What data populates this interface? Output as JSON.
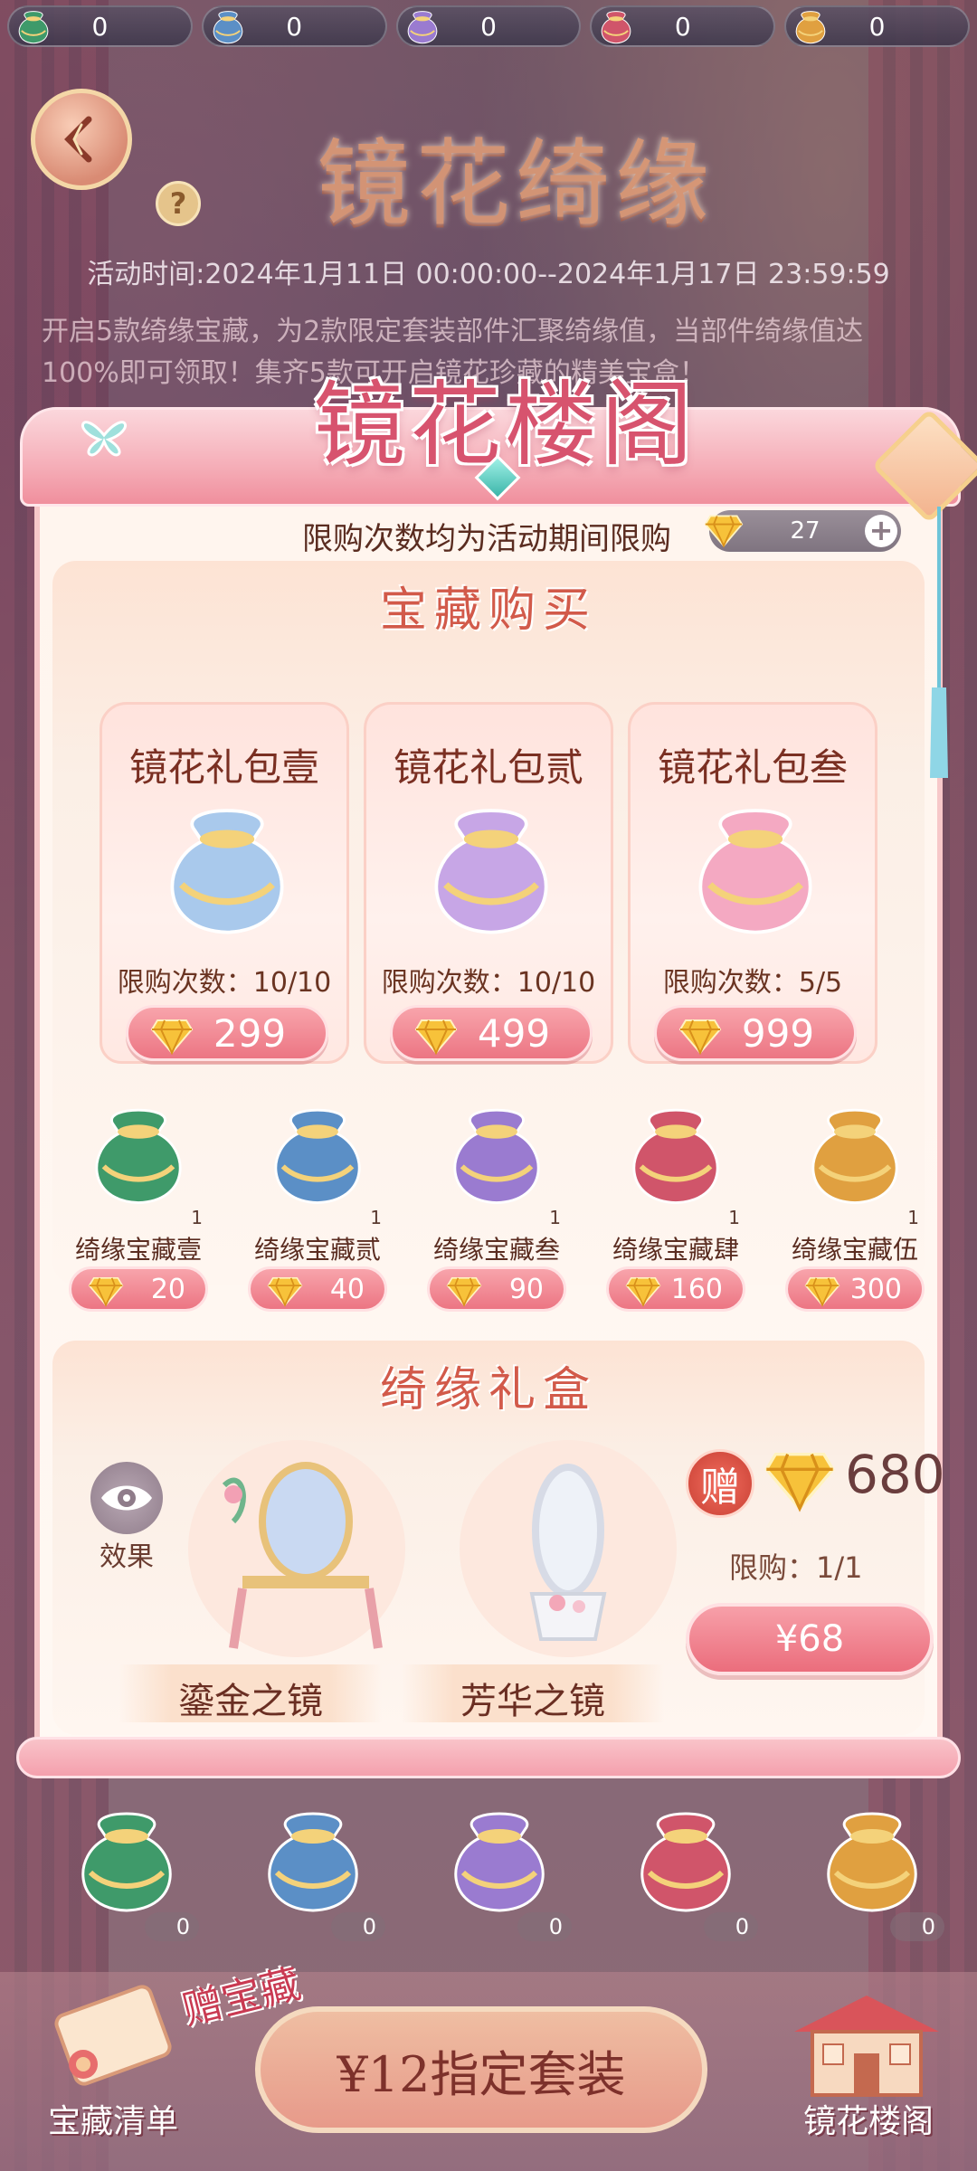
{
  "currencies": [
    {
      "icon": "bag-green-icon",
      "value": "0"
    },
    {
      "icon": "bag-blue-icon",
      "value": "0"
    },
    {
      "icon": "bag-purple-icon",
      "value": "0"
    },
    {
      "icon": "bag-red-icon",
      "value": "0"
    },
    {
      "icon": "bag-gold-icon",
      "value": "0"
    }
  ],
  "header": {
    "event_title": "镜花绮缘",
    "event_time": "活动时间:2024年1月11日 00:00:00--2024年1月17日 23:59:59",
    "event_desc_line1": "开启5款绮缘宝藏，为2款限定套装部件汇聚绮缘值，当部件绮缘值达",
    "event_desc_line2": "100%即可领取！集齐5款可开启镜花珍藏的精美宝盒！",
    "help_label": "?"
  },
  "modal": {
    "title": "镜花楼阁",
    "limit_note": "限购次数均为活动期间限购",
    "diamond_balance": "27",
    "treasure_section_title": "宝藏购买",
    "packs": [
      {
        "name": "镜花礼包壹",
        "limit": "限购次数：10/10",
        "price": "299",
        "color": "#a9c9ec"
      },
      {
        "name": "镜花礼包贰",
        "limit": "限购次数：10/10",
        "price": "499",
        "color": "#c7a6e6"
      },
      {
        "name": "镜花礼包叁",
        "limit": "限购次数：5/5",
        "price": "999",
        "color": "#f4a9c2"
      }
    ],
    "treasures": [
      {
        "name": "绮缘宝藏壹",
        "count": "1",
        "price": "20",
        "color": "#3f9a6a"
      },
      {
        "name": "绮缘宝藏贰",
        "count": "1",
        "price": "40",
        "color": "#5b8fc6"
      },
      {
        "name": "绮缘宝藏叁",
        "count": "1",
        "price": "90",
        "color": "#9a7bd0"
      },
      {
        "name": "绮缘宝藏肆",
        "count": "1",
        "price": "160",
        "color": "#d0556a"
      },
      {
        "name": "绮缘宝藏伍",
        "count": "1",
        "price": "300",
        "color": "#e0a040"
      }
    ],
    "giftbox_section_title": "绮缘礼盒",
    "effect_label": "效果",
    "mirrors": [
      {
        "name": "鎏金之镜"
      },
      {
        "name": "芳华之镜"
      }
    ],
    "gift_badge": "赠",
    "gift_amount": "680",
    "gift_limit": "限购：1/1",
    "buy_price": "¥68"
  },
  "bottom": {
    "bag_counts": [
      "0",
      "0",
      "0",
      "0",
      "0"
    ],
    "list_label": "宝藏清单",
    "gift_tag": "赠宝藏",
    "set_button": "¥12指定套装",
    "pavilion_label": "镜花楼阁"
  },
  "colors": {
    "accent_pink": "#ec7583",
    "title_red": "#d25a4a",
    "panel_bg": "#fff5ee"
  }
}
